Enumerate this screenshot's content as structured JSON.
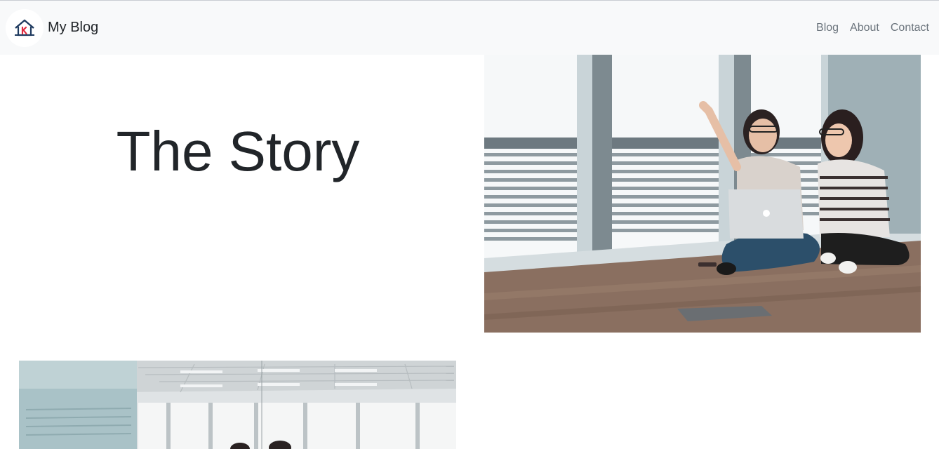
{
  "navbar": {
    "brand_text": "My Blog",
    "logo_icon": "house-k-logo-icon",
    "links": [
      {
        "label": "Blog"
      },
      {
        "label": "About"
      },
      {
        "label": "Contact"
      }
    ]
  },
  "hero": {
    "title": "The Story"
  },
  "images": [
    {
      "content": "two-women-with-laptop-sitting-on-floor-photo"
    },
    {
      "content": "office-interior-photo"
    }
  ],
  "colors": {
    "navbar_bg": "#f8f9fa",
    "link": "#6c757d",
    "text": "#212529",
    "logo_red": "#e0283e",
    "logo_navy": "#1e3a5f"
  }
}
